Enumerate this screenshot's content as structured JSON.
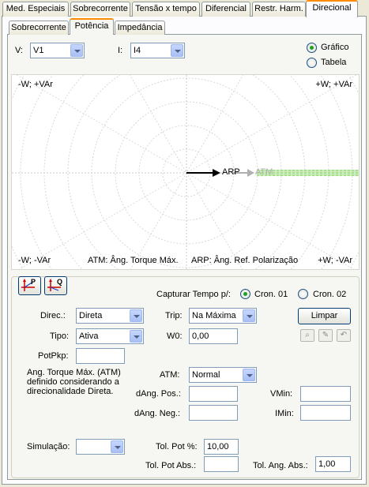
{
  "outer_tabs": [
    "Med. Especiais",
    "Sobrecorrente",
    "Tensão x tempo",
    "Diferencial",
    "Restr. Harm.",
    "Direcional"
  ],
  "inner_tabs": [
    "Sobrecorrente",
    "Potência",
    "Impedância"
  ],
  "top": {
    "v_label": "V:",
    "v_value": "V1",
    "i_label": "I:",
    "i_value": "I4",
    "view_grafico": "Gráfico",
    "view_tabela": "Tabela"
  },
  "chart": {
    "q_top_left": "-W; +VAr",
    "q_top_right": "+W; +VAr",
    "q_bottom_left": "-W; -VAr",
    "q_bottom_right": "+W; -VAr",
    "legend_atm": "ATM: Âng. Torque Máx.",
    "legend_arp": "ARP: Âng. Ref. Polarização",
    "arrow_arp": "ARP",
    "arrow_atm": "ATM"
  },
  "tool_buttons": {
    "p_label": "P",
    "q_label": "Q"
  },
  "capture": {
    "label": "Capturar Tempo p/:",
    "cron1": "Cron. 01",
    "cron2": "Cron. 02"
  },
  "form": {
    "direc_label": "Direc.:",
    "direc_value": "Direta",
    "trip_label": "Trip:",
    "trip_value": "Na Máxima",
    "limpar": "Limpar",
    "tipo_label": "Tipo:",
    "tipo_value": "Ativa",
    "w0_label": "W0:",
    "w0_value": "0,00",
    "potpkp_label": "PotPkp:",
    "potpkp_value": "",
    "note": "Ang. Torque Máx. (ATM) definido considerando a direcionalidade Direta.",
    "atm_label": "ATM:",
    "atm_value": "Normal",
    "dang_pos_label": "dAng. Pos.:",
    "dang_pos_value": "",
    "vmin_label": "VMin:",
    "vmin_value": "",
    "dang_neg_label": "dAng. Neg.:",
    "dang_neg_value": "",
    "imin_label": "IMin:",
    "imin_value": "",
    "simulacao_label": "Simulação:",
    "simulacao_value": "",
    "tol_pot_label": "Tol. Pot %:",
    "tol_pot_value": "10,00",
    "tol_pot_abs_label": "Tol. Pot Abs.:",
    "tol_pot_abs_value": "",
    "tol_ang_abs_label": "Tol. Ang. Abs.:",
    "tol_ang_abs_value": "1,00"
  }
}
